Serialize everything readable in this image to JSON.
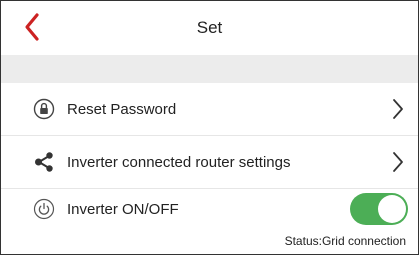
{
  "header": {
    "title": "Set",
    "back_icon": "chevron-left-icon",
    "accent_color": "#cc2222"
  },
  "settings": {
    "items": [
      {
        "label": "Reset Password",
        "icon": "lock-icon"
      },
      {
        "label": "Inverter connected router settings",
        "icon": "share-icon"
      }
    ],
    "inverter": {
      "label": "Inverter ON/OFF",
      "icon": "power-icon",
      "on": true,
      "toggle_color": "#4cae56",
      "status_text": "Status:Grid connection"
    }
  }
}
